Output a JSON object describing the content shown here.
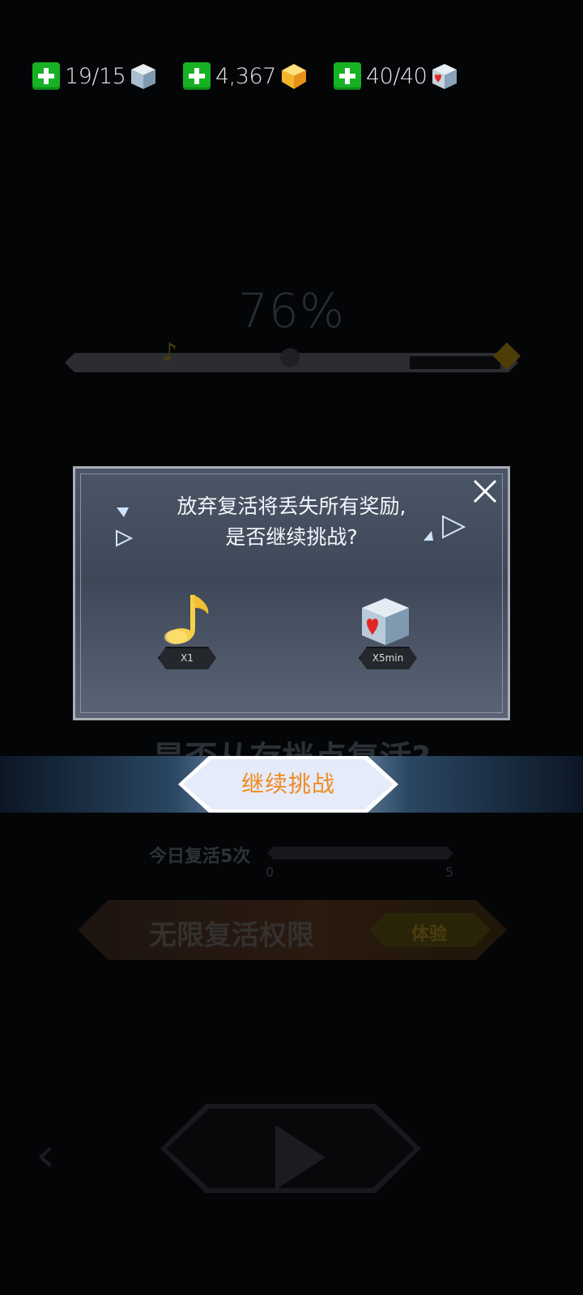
{
  "resources": [
    {
      "value": "19/15",
      "icon": "ice-cube-icon"
    },
    {
      "value": "4,367",
      "icon": "gold-gem-icon"
    },
    {
      "value": "40/40",
      "icon": "heart-cube-icon"
    }
  ],
  "background": {
    "progress_percent_text": "76%",
    "progress_fraction": 0.76,
    "revive_question": "是否从存档点复活?",
    "today_revive_label": "今日复活5次",
    "today_revive_min": "0",
    "today_revive_max": "5",
    "unlimited_revive_label": "无限复活权限",
    "trial_button_label": "体验"
  },
  "dialog": {
    "message_line1": "放弃复活将丢失所有奖励,",
    "message_line2": "是否继续挑战?",
    "rewards": [
      {
        "icon": "music-note-icon",
        "label": "X1"
      },
      {
        "icon": "heart-cube-icon",
        "label": "X5min"
      }
    ]
  },
  "continue_button_label": "继续挑战",
  "colors": {
    "plus_green": "#16b224",
    "continue_text": "#f08a22",
    "dialog_bg": "#4a5566"
  }
}
